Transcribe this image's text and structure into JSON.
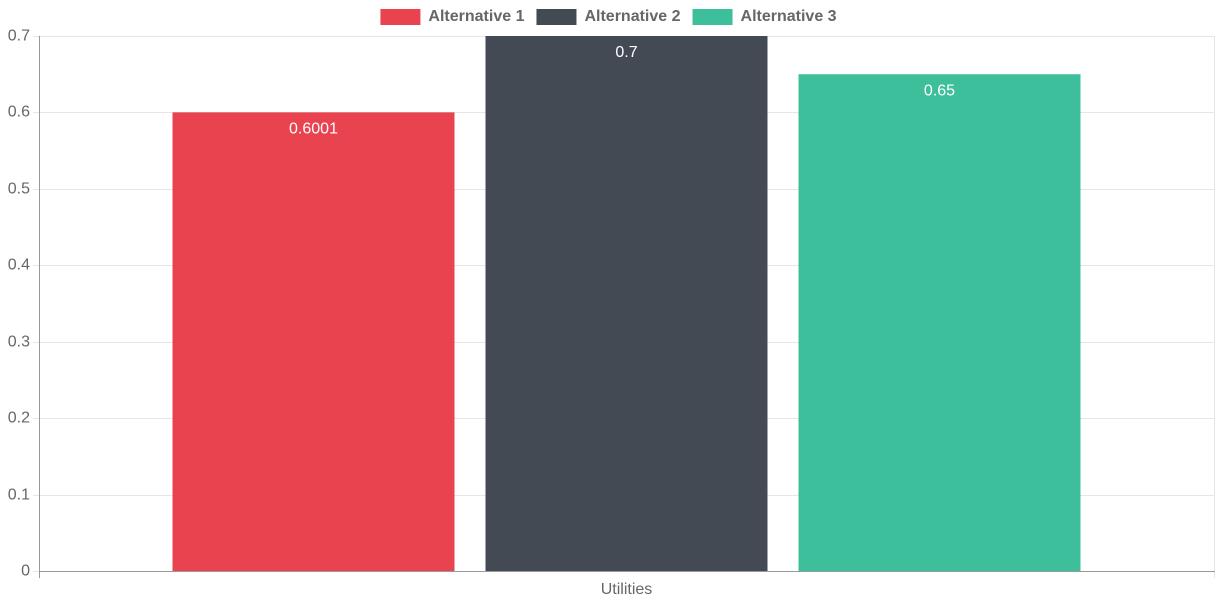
{
  "chart_data": {
    "type": "bar",
    "title": "",
    "xlabel": "",
    "ylabel": "",
    "categories": [
      "Utilities"
    ],
    "series": [
      {
        "name": "Alternative 1",
        "values": [
          0.6001
        ],
        "value_labels": [
          "0.6001"
        ],
        "color": "#e8434f"
      },
      {
        "name": "Alternative 2",
        "values": [
          0.7
        ],
        "value_labels": [
          "0.7"
        ],
        "color": "#434a54"
      },
      {
        "name": "Alternative 3",
        "values": [
          0.65
        ],
        "value_labels": [
          "0.65"
        ],
        "color": "#3ebf9b"
      }
    ],
    "ylim": [
      0,
      0.7
    ],
    "yticks": [
      "0",
      "0.1",
      "0.2",
      "0.3",
      "0.4",
      "0.5",
      "0.6",
      "0.7"
    ],
    "grid": true,
    "legend_position": "top-center",
    "colors": {
      "grid": "#e6e6e6",
      "axis": "#999999",
      "tick_text": "#666666",
      "legend_text": "#666666",
      "value_label_text": "#ffffff"
    }
  }
}
